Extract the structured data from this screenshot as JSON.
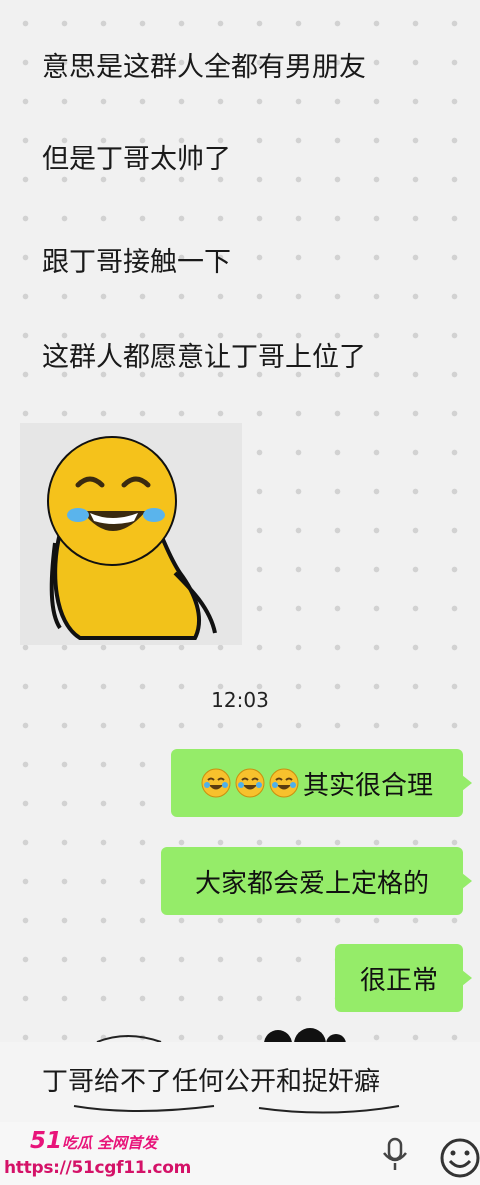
{
  "incoming": [
    "意思是这群人全都有男朋友",
    "但是丁哥太帅了",
    "跟丁哥接触一下",
    "这群人都愿意让丁哥上位了"
  ],
  "timestamp": "12:03",
  "outgoing": [
    {
      "text": "其实很合理",
      "emoji_icon": "laughing-crying-emoji",
      "emoji_count": 3
    },
    {
      "text": "大家都会爱上定格的"
    },
    {
      "text": "很正常"
    }
  ],
  "bottom_message": "丁哥给不了任何公开和捉奸癖",
  "watermark": {
    "brand_number": "51",
    "brand_text": "吃瓜 全网首发",
    "url": "https://51cgf11.com"
  },
  "input_bar": {
    "voice_icon": "microphone-icon",
    "emoji_icon": "smiley-icon"
  },
  "colors": {
    "outgoing_bubble": "#95ec69",
    "background": "#f1f1f1",
    "watermark": "#e8147a"
  }
}
